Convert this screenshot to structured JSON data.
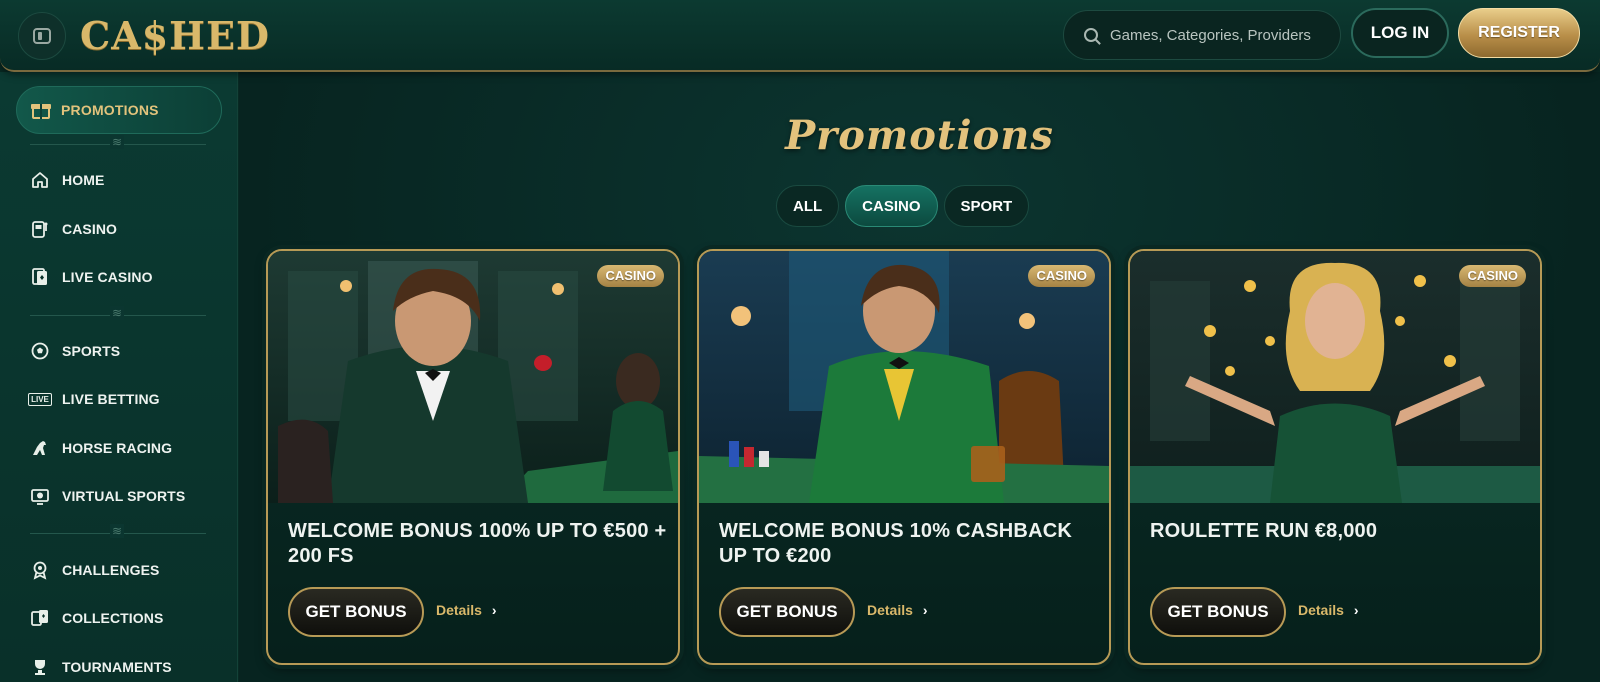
{
  "header": {
    "logo_text": "CA$HED",
    "search_placeholder": "Games, Categories, Providers",
    "login_label": "LOG IN",
    "register_label": "REGISTER"
  },
  "sidebar": {
    "promotions_label": "PROMOTIONS",
    "groups": [
      [
        {
          "label": "HOME",
          "icon": "home-icon"
        },
        {
          "label": "CASINO",
          "icon": "slot-machine-icon"
        },
        {
          "label": "LIVE CASINO",
          "icon": "playing-card-icon"
        }
      ],
      [
        {
          "label": "SPORTS",
          "icon": "soccer-ball-icon"
        },
        {
          "label": "LIVE BETTING",
          "icon": "live-badge-icon"
        },
        {
          "label": "HORSE RACING",
          "icon": "horse-icon"
        },
        {
          "label": "VIRTUAL SPORTS",
          "icon": "virtual-screen-icon"
        }
      ],
      [
        {
          "label": "CHALLENGES",
          "icon": "medal-icon"
        },
        {
          "label": "COLLECTIONS",
          "icon": "cards-icon"
        },
        {
          "label": "TOURNAMENTS",
          "icon": "trophy-icon"
        }
      ]
    ],
    "live_badge_text": "LIVE"
  },
  "main": {
    "title": "Promotions",
    "tabs": [
      {
        "label": "ALL",
        "active": false
      },
      {
        "label": "CASINO",
        "active": true
      },
      {
        "label": "SPORT",
        "active": false
      }
    ],
    "cards": [
      {
        "tag": "CASINO",
        "title": "WELCOME BONUS 100% UP TO €500 + 200 FS",
        "button": "GET BONUS",
        "details": "Details"
      },
      {
        "tag": "CASINO",
        "title": "WELCOME BONUS 10% CASHBACK UP TO €200",
        "button": "GET BONUS",
        "details": "Details"
      },
      {
        "tag": "CASINO",
        "title": "ROULETTE RUN €8,000",
        "button": "GET BONUS",
        "details": "Details"
      }
    ]
  },
  "colors": {
    "background": "#082923",
    "accent_gold": "#d9b86a",
    "tab_active": "#157262"
  }
}
